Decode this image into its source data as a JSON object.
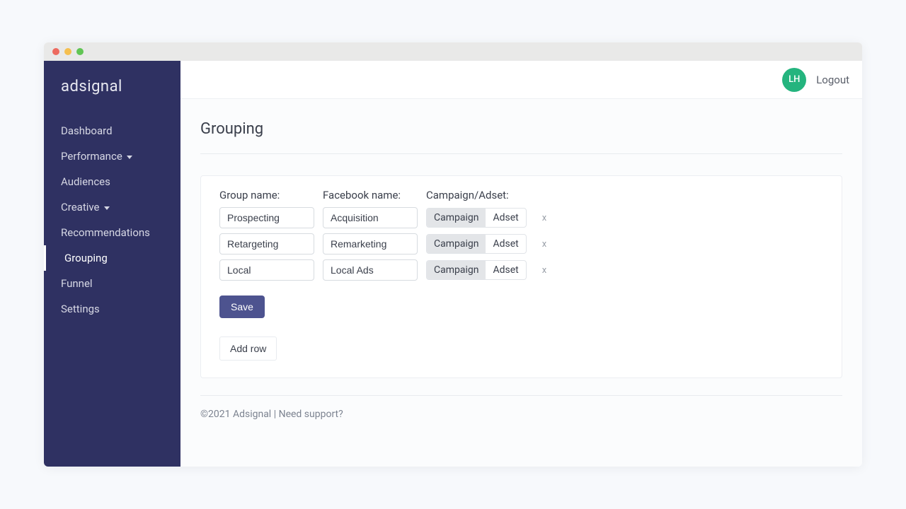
{
  "brand": "adsignal",
  "sidebar": {
    "items": [
      {
        "label": "Dashboard",
        "dropdown": false
      },
      {
        "label": "Performance",
        "dropdown": true
      },
      {
        "label": "Audiences",
        "dropdown": false
      },
      {
        "label": "Creative",
        "dropdown": true
      },
      {
        "label": "Recommendations",
        "dropdown": false
      },
      {
        "label": "Grouping",
        "dropdown": false,
        "active": true
      },
      {
        "label": "Funnel",
        "dropdown": false
      },
      {
        "label": "Settings",
        "dropdown": false
      }
    ]
  },
  "header": {
    "avatar_initials": "LH",
    "logout": "Logout"
  },
  "page": {
    "title": "Grouping",
    "columns": {
      "group_name": "Group name:",
      "facebook_name": "Facebook name:",
      "campaign_adset": "Campaign/Adset:"
    },
    "toggle": {
      "campaign": "Campaign",
      "adset": "Adset"
    },
    "rows": [
      {
        "group_name": "Prospecting",
        "facebook_name": "Acquisition",
        "selected": "campaign"
      },
      {
        "group_name": "Retargeting",
        "facebook_name": "Remarketing",
        "selected": "campaign"
      },
      {
        "group_name": "Local",
        "facebook_name": "Local Ads",
        "selected": "campaign"
      }
    ],
    "delete_label": "x",
    "save": "Save",
    "add_row": "Add row"
  },
  "footer": {
    "copyright": "©2021 Adsignal",
    "separator": " | ",
    "support": "Need support?"
  }
}
